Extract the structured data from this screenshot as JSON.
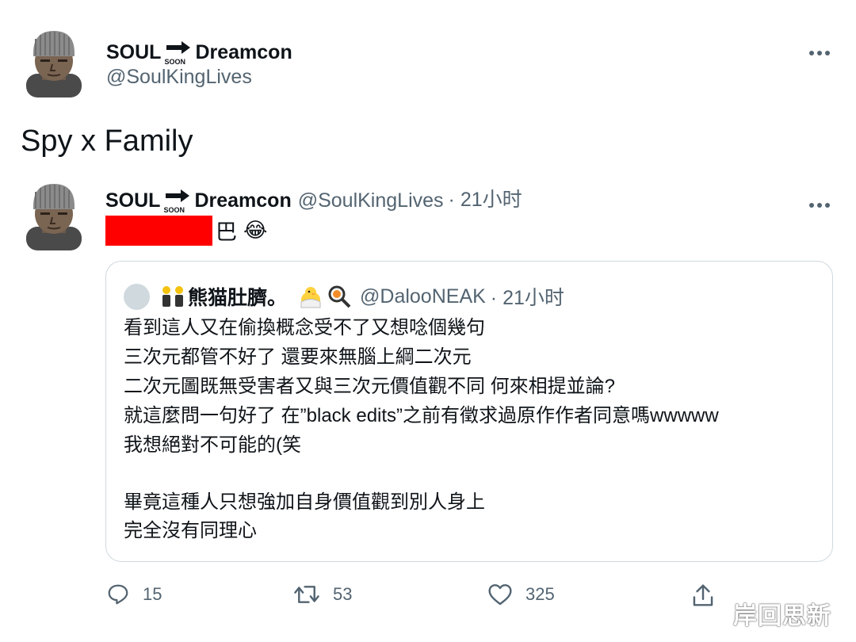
{
  "main_tweet": {
    "author": {
      "name_left": "SOUL",
      "soon_label": "SOON",
      "name_right": "Dreamcon",
      "handle": "@SoulKingLives"
    },
    "text": "Spy x Family",
    "more_icon": "more-icon"
  },
  "reply_tweet": {
    "author": {
      "name_left": "SOUL",
      "soon_label": "SOON",
      "name_right": "Dreamcon",
      "handle": "@SoulKingLives",
      "time": "· 21小时"
    },
    "text_after_redaction": "巴",
    "emoji": "😂",
    "redaction_color": "#ff0000"
  },
  "quoted_tweet": {
    "author": {
      "name": "熊猫肚臍。",
      "handle": "@DalooNEAK",
      "time": "· 21小时"
    },
    "lines": [
      "看到這人又在偷換概念受不了又想唸個幾句",
      "三次元都管不好了 還要來無腦上綱二次元",
      "二次元圖既無受害者又與三次元價值觀不同 何來相提並論?",
      "就這麼問一句好了 在”black edits”之前有徵求過原作作者同意嗎wwwww",
      "我想絕對不可能的(笑",
      "畢竟這種人只想強加自身價值觀到別人身上",
      "完全沒有同理心"
    ]
  },
  "actions": {
    "reply_count": "15",
    "retweet_count": "53",
    "like_count": "325"
  },
  "watermark": "岸回思新"
}
